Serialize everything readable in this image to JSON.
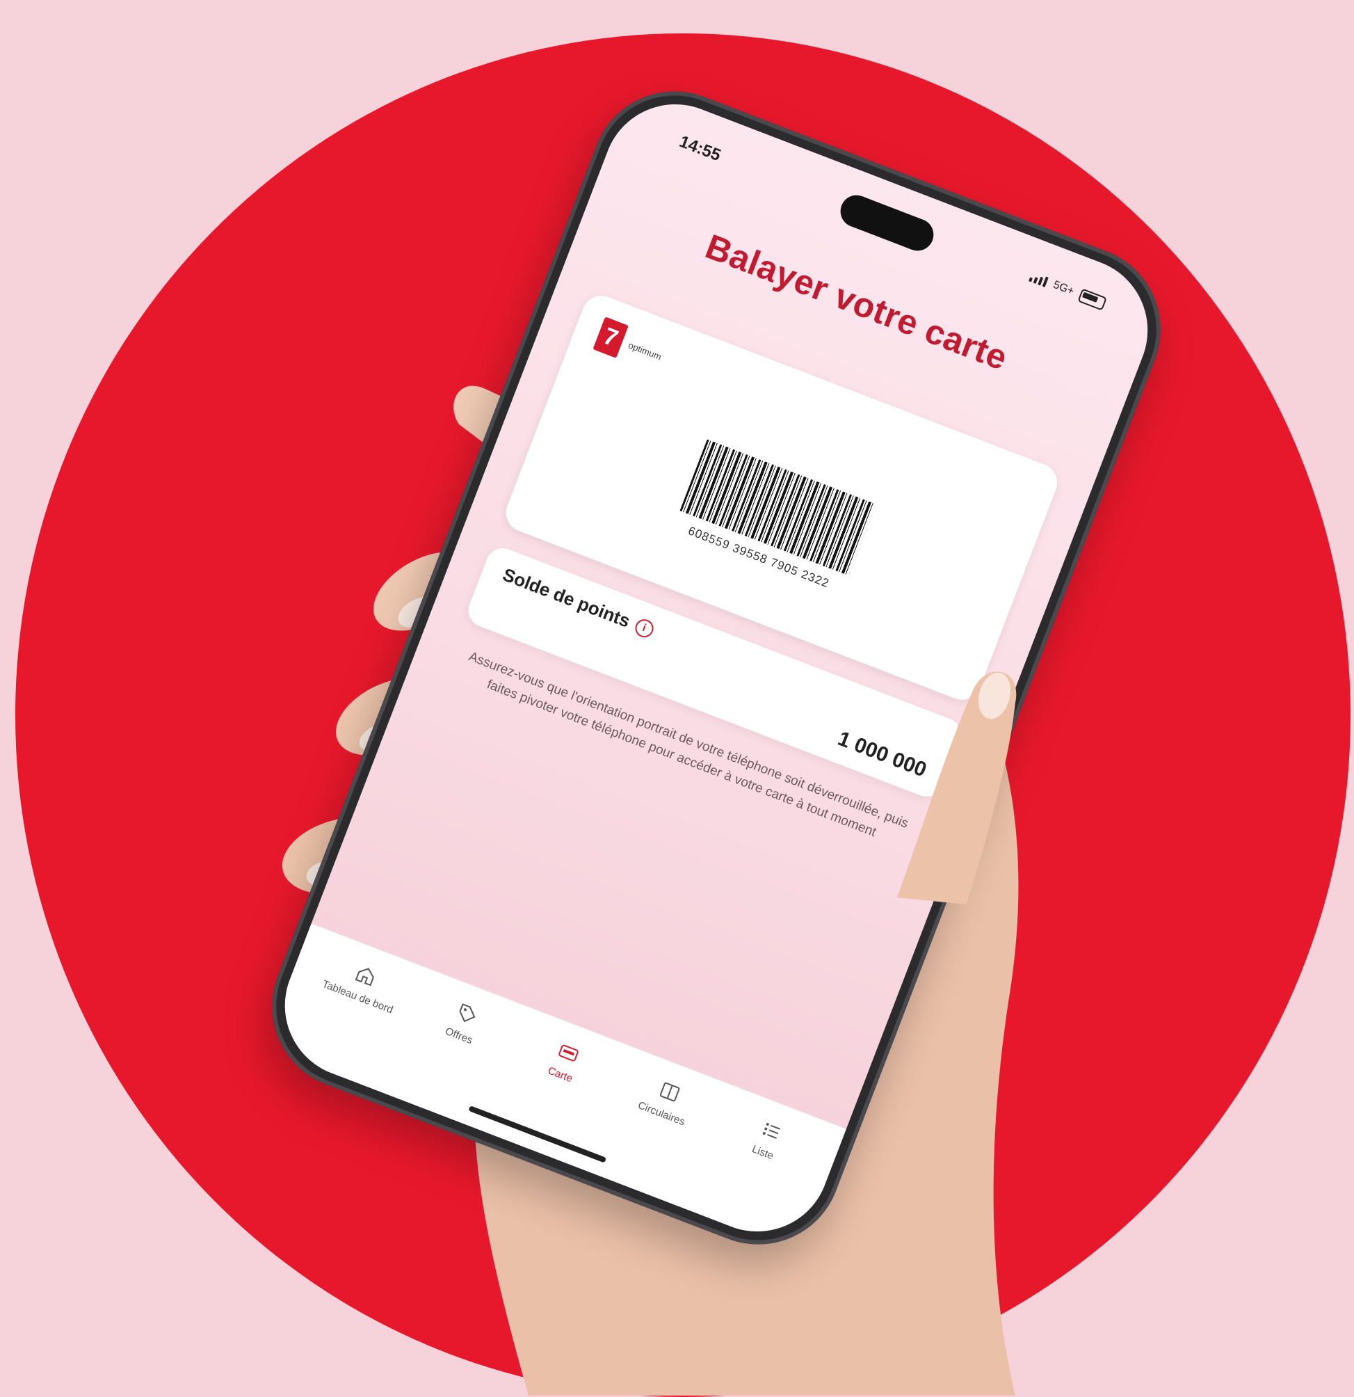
{
  "status_bar": {
    "time": "14:55",
    "network": "5G+"
  },
  "screen": {
    "title": "Balayer votre carte",
    "card": {
      "brand_name": "optimum",
      "number": "608559 39558 7905 2322"
    },
    "points": {
      "label": "Solde de points",
      "value": "1 000 000"
    },
    "hint": "Assurez-vous que l'orientation portrait de votre téléphone soit déverrouillée, puis faites pivoter votre téléphone pour accéder à votre carte à tout moment"
  },
  "tabs": [
    {
      "label": "Tableau de bord",
      "icon": "home-icon"
    },
    {
      "label": "Offres",
      "icon": "tag-icon"
    },
    {
      "label": "Carte",
      "icon": "card-icon",
      "active": true
    },
    {
      "label": "Circulaires",
      "icon": "flyer-icon"
    },
    {
      "label": "Liste",
      "icon": "list-icon"
    }
  ],
  "colors": {
    "background": "#f6d2da",
    "disc": "#e8182c",
    "accent": "#d61a2e",
    "title": "#c11b32"
  }
}
